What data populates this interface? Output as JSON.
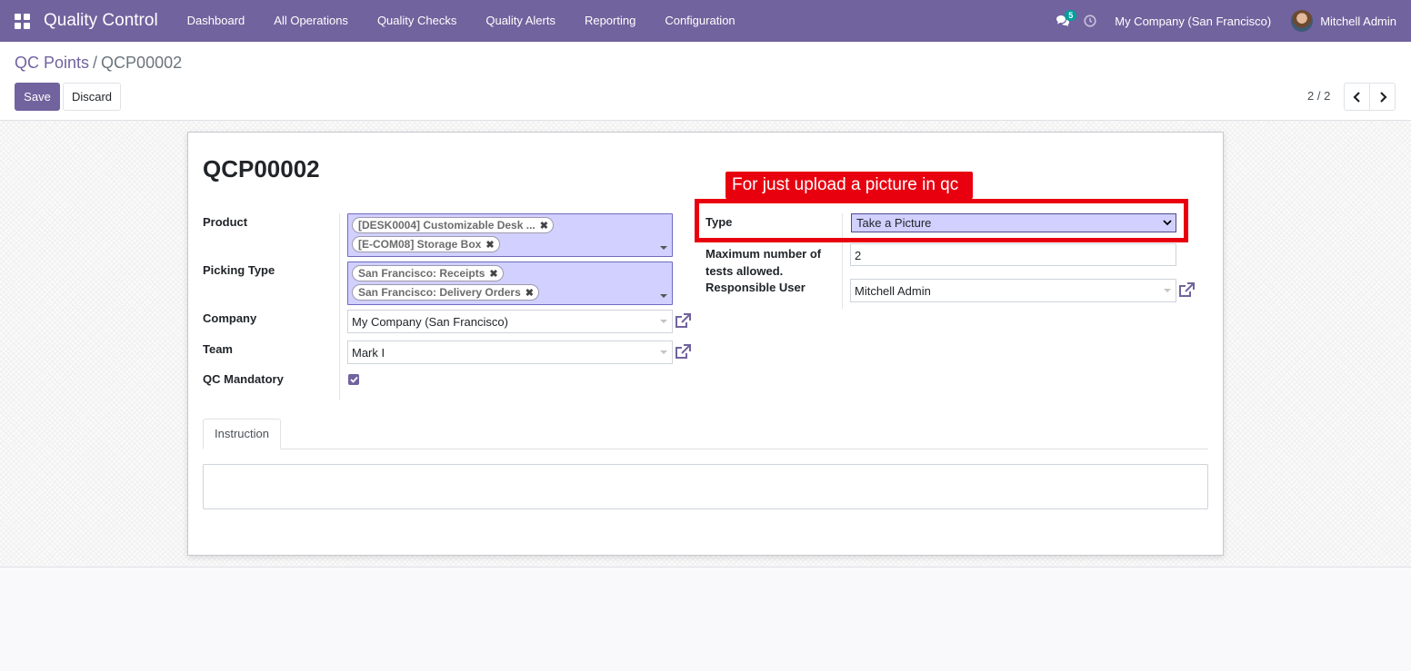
{
  "navbar": {
    "app_name": "Quality Control",
    "menu": [
      "Dashboard",
      "All Operations",
      "Quality Checks",
      "Quality Alerts",
      "Reporting",
      "Configuration"
    ],
    "messages_count": "5",
    "company": "My Company (San Francisco)",
    "user": "Mitchell Admin"
  },
  "control_panel": {
    "breadcrumb_parent": "QC Points",
    "breadcrumb_separator": "/",
    "breadcrumb_current": "QCP00002",
    "save_label": "Save",
    "discard_label": "Discard",
    "pager": "2 / 2"
  },
  "form": {
    "record_name": "QCP00002",
    "product_label": "Product",
    "product_tags": [
      "[DESK0004] Customizable Desk ...",
      "[E-COM08] Storage Box"
    ],
    "picking_type_label": "Picking Type",
    "picking_type_tags": [
      "San Francisco: Receipts",
      "San Francisco: Delivery Orders"
    ],
    "company_label": "Company",
    "company_value": "My Company (San Francisco)",
    "team_label": "Team",
    "team_value": "Mark I",
    "qc_mandatory_label": "QC Mandatory",
    "qc_mandatory_checked": true,
    "type_label": "Type",
    "type_value": "Take a Picture",
    "max_tests_label": "Maximum number of tests allowed.",
    "max_tests_value": "2",
    "responsible_label": "Responsible User",
    "responsible_value": "Mitchell Admin",
    "tab_instruction": "Instruction"
  },
  "annotation": {
    "text": "For just upload a picture in qc",
    "color": "#e8000f"
  },
  "colors": {
    "brand": "#71639e",
    "required_field": "#d1d0ff"
  }
}
